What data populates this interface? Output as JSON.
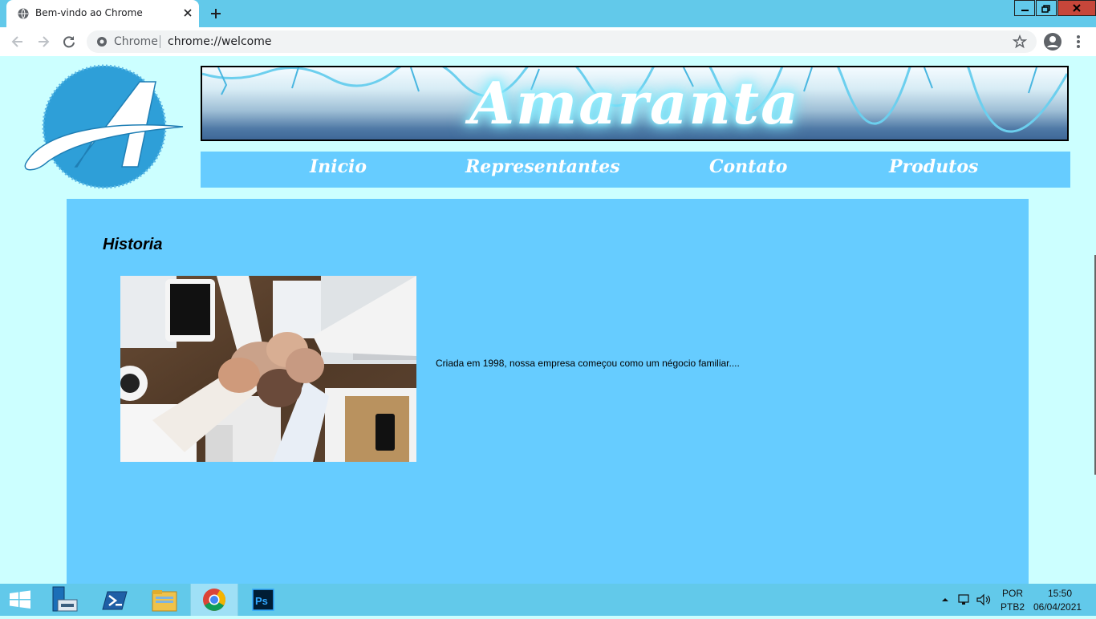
{
  "browser": {
    "tab_title": "Bem-vindo ao Chrome",
    "address_chip": "Chrome",
    "url": "chrome://welcome"
  },
  "site": {
    "banner_title": "Amaranta",
    "nav": [
      {
        "label": "Inicio"
      },
      {
        "label": "Representantes"
      },
      {
        "label": "Contato"
      },
      {
        "label": "Produtos"
      }
    ],
    "section_title": "Historia",
    "paragraph": "Criada em 1998, nossa empresa começou como um négocio familiar....",
    "colors": {
      "page_bg": "#ccffff",
      "nav_bg": "#66ccff",
      "content_bg": "#66ccff",
      "logo_blue": "#2e9fd8"
    }
  },
  "taskbar": {
    "apps": [
      {
        "name": "windows-start-icon"
      },
      {
        "name": "server-manager-icon"
      },
      {
        "name": "powershell-icon"
      },
      {
        "name": "file-explorer-icon"
      },
      {
        "name": "chrome-icon",
        "active": true
      },
      {
        "name": "photoshop-icon"
      }
    ],
    "language_top": "POR",
    "language_bottom": "PTB2",
    "time": "15:50",
    "date": "06/04/2021"
  }
}
